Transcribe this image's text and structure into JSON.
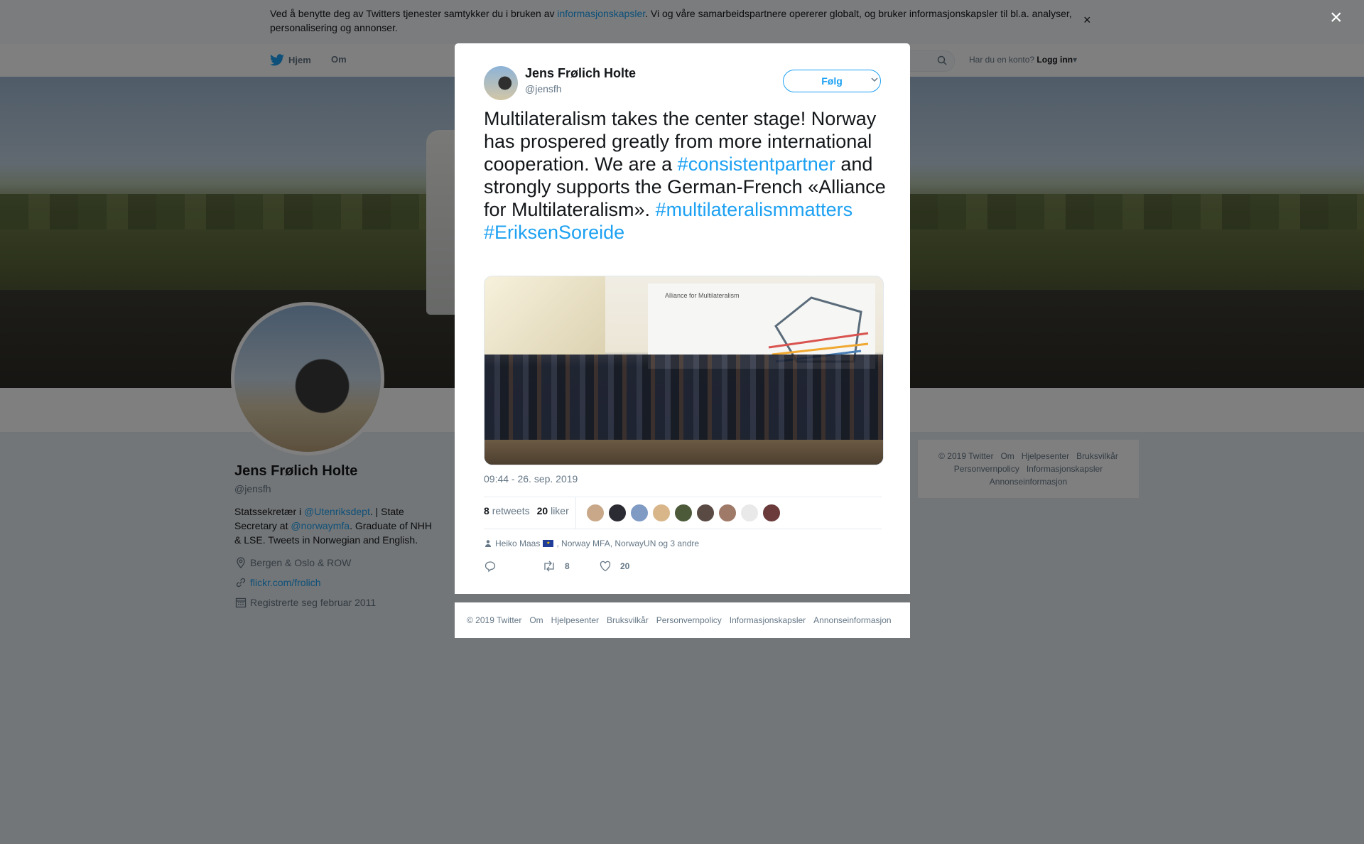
{
  "cookie": {
    "text_before": "Ved å benytte deg av Twitters tjenester samtykker du i bruken av ",
    "link": "informasjonskapsler",
    "text_after": ". Vi og våre samarbeidspartnere opererer globalt, og bruker informasjonskapsler til bl.a. analyser, personalisering og annonser.",
    "close": "×"
  },
  "nav": {
    "home": "Hjem",
    "about": "Om",
    "login_prompt": "Har du en konto?",
    "login": "Logg inn"
  },
  "profile": {
    "name": "Jens Frølich Holte",
    "handle": "@jensfh",
    "bio_1": "Statssekretær i ",
    "bio_mention_1": "@Utenriksdept",
    "bio_2": ". | State Secretary at ",
    "bio_mention_2": "@norwaymfa",
    "bio_3": ". Graduate of NHH & LSE. Tweets in Norwegian and English.",
    "location": "Bergen & Oslo & ROW",
    "website": "flickr.com/frolich",
    "joined": "Registrerte seg februar 2011"
  },
  "side_footer": {
    "row1": [
      "© 2019 Twitter",
      "Om",
      "Hjelpesenter",
      "Bruksvilkår"
    ],
    "row2": [
      "Personvernpolicy",
      "Informasjonskapsler"
    ],
    "row3": [
      "Annonseinformasjon"
    ]
  },
  "overlay": {
    "close": "×"
  },
  "tweet": {
    "author_name": "Jens Frølich Holte",
    "author_handle": "@jensfh",
    "follow": "Følg",
    "text_1": "Multilateralism takes the center stage! Norway has prospered greatly from more international cooperation. We are a ",
    "hashtag_1": "#consistentpartner",
    "text_2": " and strongly supports the German-French «Alliance for Multilateralism». ",
    "hashtag_2": "#multilateralismmatters",
    "hashtag_3": "#EriksenSoreide",
    "image_board_title": "Alliance for Multilateralism",
    "timestamp": "09:44 - 26. sep. 2019",
    "retweets_count": "8",
    "retweets_label": "retweets",
    "likes_count": "20",
    "likes_label": "liker",
    "context_names_1": "Heiko Maas",
    "context_names_2": ", Norway MFA, NorwayUN og 3 andre",
    "action_retweets": "8",
    "action_likes": "20"
  },
  "modal_footer": [
    "© 2019 Twitter",
    "Om",
    "Hjelpesenter",
    "Bruksvilkår",
    "Personvernpolicy",
    "Informasjonskapsler",
    "Annonseinformasjon"
  ],
  "colors": {
    "accent": "#1da1f2",
    "text": "#14171a",
    "muted": "#657786",
    "background": "#e6ecf0"
  },
  "likers": [
    {
      "name": "liker-avatar",
      "color": "#c8a889"
    },
    {
      "name": "liker-avatar",
      "color": "#2b2b33"
    },
    {
      "name": "liker-avatar",
      "color": "#7f9bc4"
    },
    {
      "name": "liker-avatar",
      "color": "#d8b68a"
    },
    {
      "name": "liker-avatar",
      "color": "#4d5a3a"
    },
    {
      "name": "liker-avatar",
      "color": "#5a4a44"
    },
    {
      "name": "liker-avatar",
      "color": "#a07a68"
    },
    {
      "name": "liker-avatar",
      "color": "#e9e9e9"
    },
    {
      "name": "liker-avatar",
      "color": "#6b3b3b"
    }
  ]
}
